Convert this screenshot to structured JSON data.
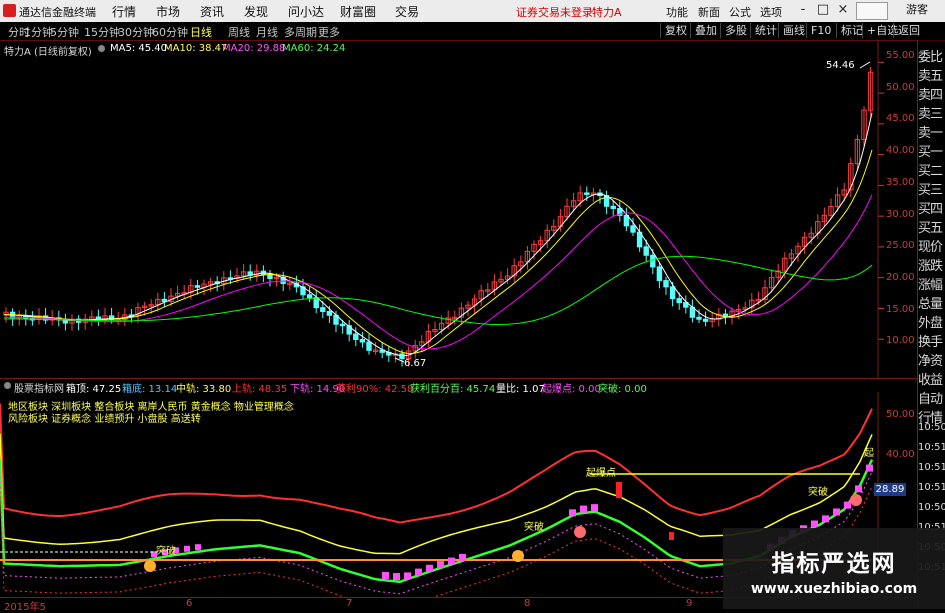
{
  "app": {
    "title": "通达信金融终端"
  },
  "menu": [
    "行情",
    "市场",
    "资讯",
    "发现",
    "问小达",
    "财富圈",
    "交易"
  ],
  "status_notice": "证券交易未登录",
  "stock_header": "特力A",
  "right_menu": [
    "功能",
    "新面",
    "公式",
    "选项"
  ],
  "window_buttons": [
    "-",
    "□",
    "×"
  ],
  "periods": [
    "分时",
    "1分钟",
    "5分钟",
    "15分钟",
    "30分钟",
    "60分钟",
    "日线",
    "周线",
    "月线",
    "多周期",
    "更多"
  ],
  "active_period": "日线",
  "tools": [
    "复权",
    "叠加",
    "多股",
    "统计",
    "画线",
    "F10",
    "标记",
    "+自选",
    "返回"
  ],
  "main_info": {
    "stock": "特力A (日线前复权)",
    "ma5": "MA5: 45.40",
    "ma10": "MA10: 38.47",
    "ma20": "MA20: 29.88",
    "ma60": "MA60: 24.24"
  },
  "price_axis": [
    "55.00",
    "50.00",
    "45.00",
    "40.00",
    "35.00",
    "30.00",
    "25.00",
    "20.00",
    "15.00",
    "10.00"
  ],
  "annotations": {
    "high": "54.46",
    "low": "6.67"
  },
  "side_panel": [
    "委比",
    "卖五",
    "卖四",
    "卖三",
    "卖一",
    "买一",
    "买二",
    "买三",
    "买四",
    "买五",
    "现价",
    "涨跌",
    "涨幅",
    "总量",
    "外盘",
    "换手",
    "净资",
    "收益",
    "自动",
    "行情"
  ],
  "indicator": {
    "name": "股票指标网",
    "items": [
      {
        "label": "箱顶: 47.25",
        "color": "#ffffff"
      },
      {
        "label": "箱底: 13.14",
        "color": "#4fc7ff"
      },
      {
        "label": "中轨: 33.80",
        "color": "#ffff4f"
      },
      {
        "label": "上轨: 48.35",
        "color": "#ff3030"
      },
      {
        "label": "下轨: 14.90",
        "color": "#ff4fff"
      },
      {
        "label": "获利90%: 42.58",
        "color": "#ff3030"
      },
      {
        "label": "获利百分百: 45.74",
        "color": "#4fff4f"
      },
      {
        "label": "量比: 1.07",
        "color": "#ffffff"
      },
      {
        "label": "起爆点: 0.00",
        "color": "#ff4fff"
      },
      {
        "label": "突破: 0.00",
        "color": "#4fff4f"
      }
    ],
    "concepts_line1": "地区板块 深圳板块 整合板块 离岸人民币 黄金概念 物业管理概念",
    "concepts_line2": "风险板块 证券概念 业绩预升 小盘股 高送转"
  },
  "indicator_axis": [
    "50.00",
    "40.00"
  ],
  "time_axis_right": [
    "10:50",
    "10:51",
    "10:51",
    "10:51",
    "10:50",
    "10:51",
    "10:50",
    "10:51"
  ],
  "current_value": "28.89",
  "chart_labels": {
    "qibao": "起爆点",
    "tupo": "突破",
    "qi": "起",
    "break2": "突破"
  },
  "x_axis": [
    "2015年5",
    "6",
    "7",
    "8",
    "9"
  ],
  "watermark": {
    "cn": "指标严选网",
    "url": "www.xuezhibiao.com"
  },
  "colors": {
    "up": "#ff3c3c",
    "down": "#54ffff",
    "ma5": "#ffffff",
    "ma10": "#ffff00",
    "ma20": "#ff00ff",
    "ma60": "#00ff00"
  },
  "chart_data": {
    "type": "candlestick",
    "title": "特力A (日线前复权)",
    "ylim": [
      5,
      57
    ],
    "ma": [
      {
        "name": "MA5",
        "value": 45.4
      },
      {
        "name": "MA10",
        "value": 38.47
      },
      {
        "name": "MA20",
        "value": 29.88
      },
      {
        "name": "MA60",
        "value": 24.24
      }
    ],
    "high_mark": 54.46,
    "low_mark": 6.67
  }
}
